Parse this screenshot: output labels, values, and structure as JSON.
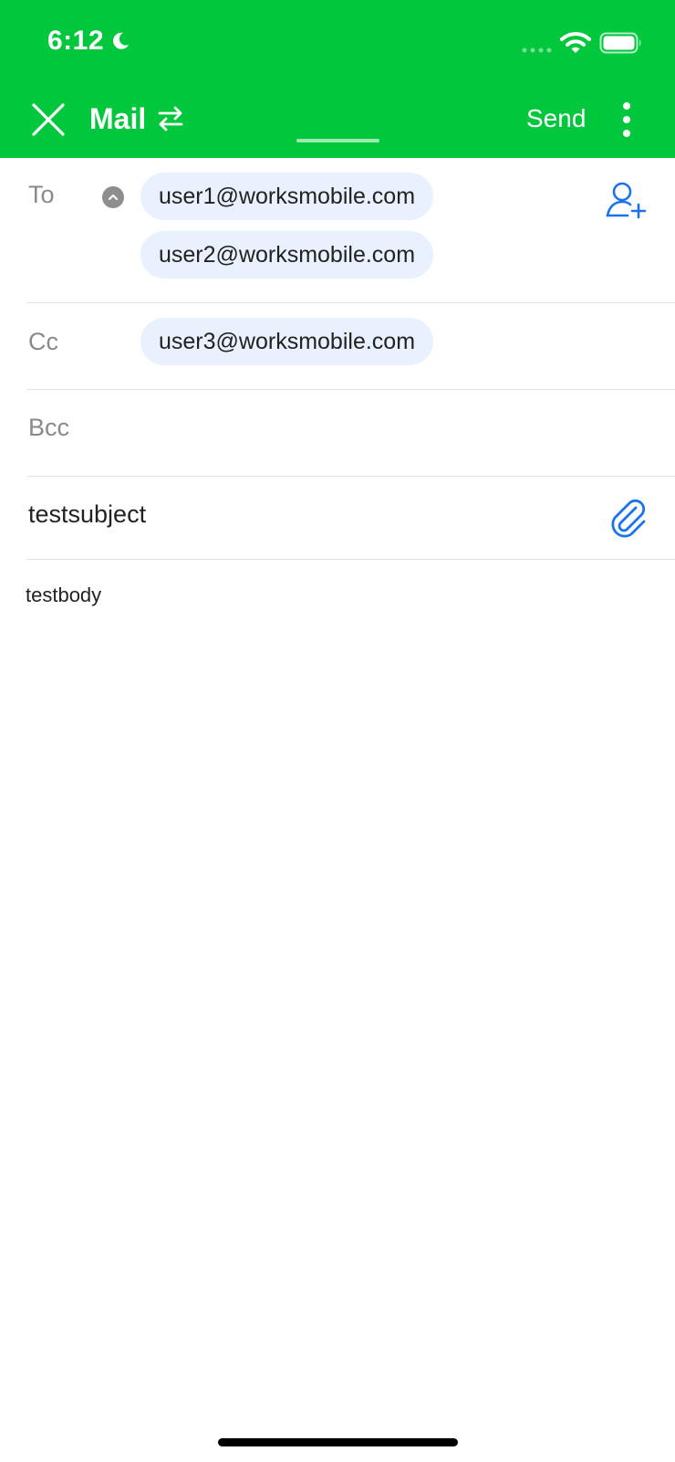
{
  "status_bar": {
    "time": "6:12",
    "icons": [
      "moon-icon",
      "cellular-signal-icon",
      "wifi-icon",
      "battery-icon"
    ]
  },
  "header": {
    "close_icon": "close-icon",
    "title": "Mail",
    "switch_icon": "swap-arrows-icon",
    "send_label": "Send",
    "more_icon": "more-vertical-icon"
  },
  "compose": {
    "to": {
      "label": "To",
      "recipients": [
        "user1@worksmobile.com",
        "user2@worksmobile.com"
      ],
      "toggle_icon": "chevron-up-icon",
      "add_icon": "add-contact-icon"
    },
    "cc": {
      "label": "Cc",
      "recipients": [
        "user3@worksmobile.com"
      ]
    },
    "bcc": {
      "label": "Bcc"
    },
    "subject": "testsubject",
    "attach_icon": "paperclip-icon",
    "body": "testbody"
  },
  "colors": {
    "header_bg": "#00c73c",
    "chip_bg": "#e8f1fd",
    "accent_blue": "#1a73e8",
    "label_gray": "#8a8a8a"
  }
}
